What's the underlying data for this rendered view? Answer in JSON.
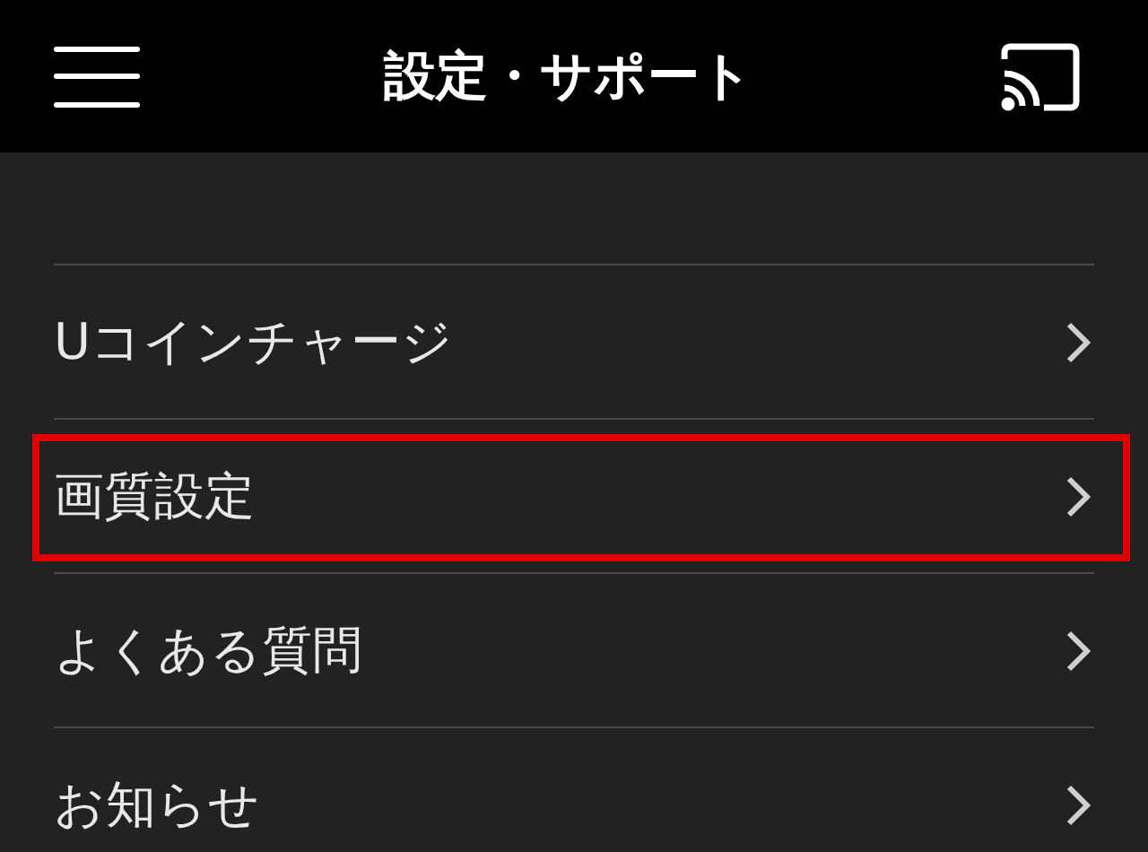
{
  "header": {
    "title": "設定・サポート"
  },
  "menu": [
    {
      "label": "Uコインチャージ",
      "highlighted": false
    },
    {
      "label": "画質設定",
      "highlighted": true
    },
    {
      "label": "よくある質問",
      "highlighted": false
    },
    {
      "label": "お知らせ",
      "highlighted": false
    }
  ]
}
